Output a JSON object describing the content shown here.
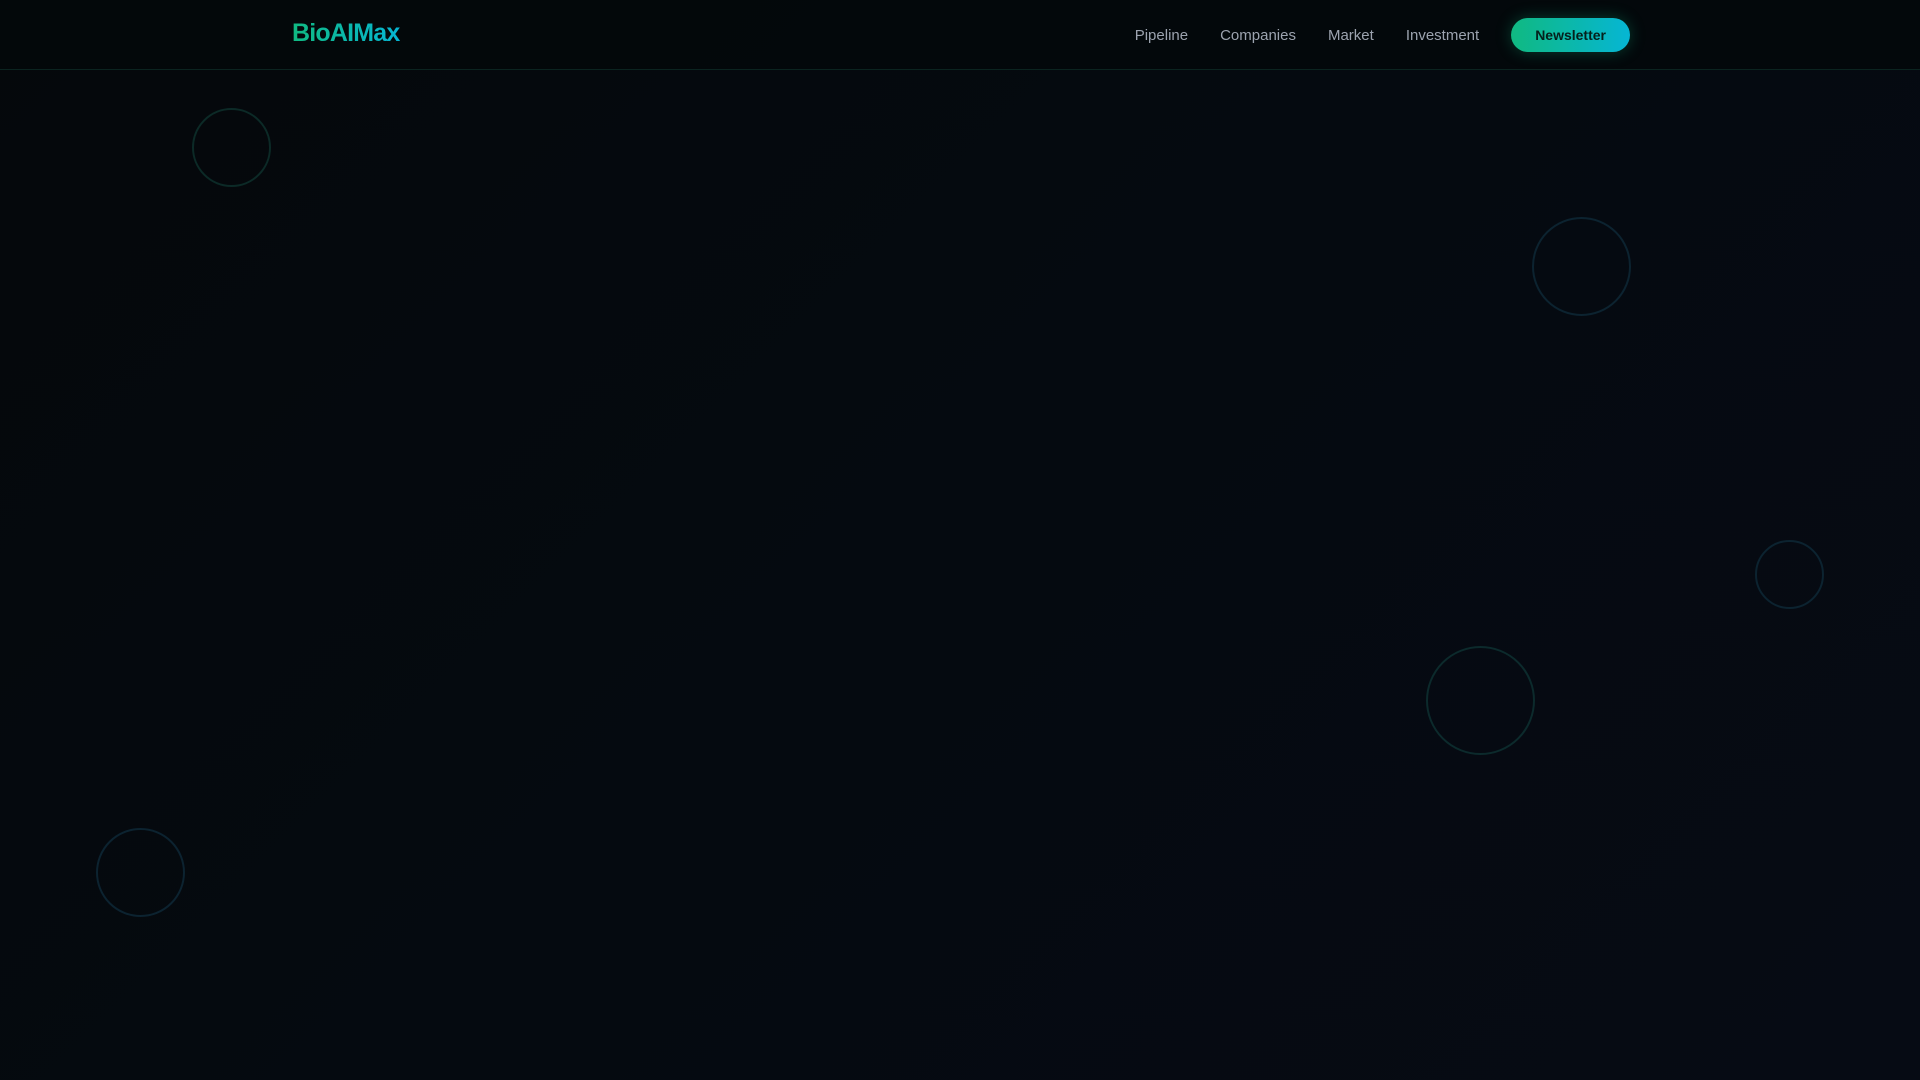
{
  "header": {
    "logo": "BioAIMax",
    "nav": [
      "Pipeline",
      "Companies",
      "Market",
      "Investment"
    ],
    "cta_label": "Newsletter"
  },
  "colors": {
    "accent_start": "#10b981",
    "accent_end": "#06b6d4",
    "background": "#05090e"
  }
}
